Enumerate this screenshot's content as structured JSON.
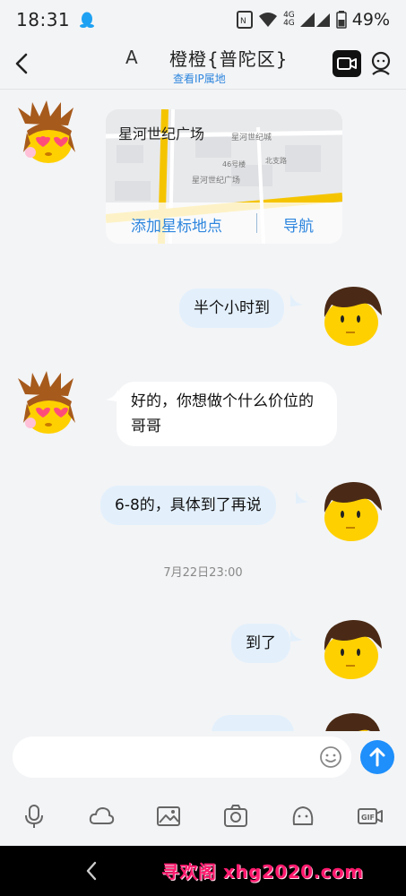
{
  "status_bar": {
    "time": "18:31",
    "network_top": "4G",
    "network_bottom": "4G",
    "battery": "49%",
    "icons": [
      "qq-icon",
      "nfc-icon",
      "wifi-icon",
      "signal-icon",
      "battery-icon"
    ]
  },
  "header": {
    "letter": "A",
    "title": "橙橙{普陀区}",
    "subtitle": "查看IP属地",
    "icons": [
      "back-icon",
      "video-call-icon",
      "profile-icon"
    ]
  },
  "map_card": {
    "place_name": "星河世纪广场",
    "add_star_label": "添加星标地点",
    "navigate_label": "导航",
    "map_labels": [
      "星河世纪城",
      "星河世纪广场",
      "46号楼",
      "北支路"
    ]
  },
  "messages": [
    {
      "side": "right",
      "text": "半个小时到"
    },
    {
      "side": "left",
      "text": "好的，你想做个什么价位的哥哥"
    },
    {
      "side": "right",
      "text": "6-8的，具体到了再说"
    },
    {
      "side": "right",
      "text": "到了"
    }
  ],
  "timestamp": "7月22日23:00",
  "input": {
    "placeholder": ""
  },
  "toolbar": [
    "mic-icon",
    "cloud-icon",
    "image-icon",
    "camera-icon",
    "sticker-icon",
    "gif-icon"
  ],
  "watermark": "寻欢阁 xhg2020.com",
  "colors": {
    "accent": "#1e8ffb",
    "link": "#2e86de",
    "bubble_right": "#e3f0fc",
    "bubble_left": "#ffffff",
    "background": "#f3f4f6",
    "watermark": "#ff1a6e"
  }
}
